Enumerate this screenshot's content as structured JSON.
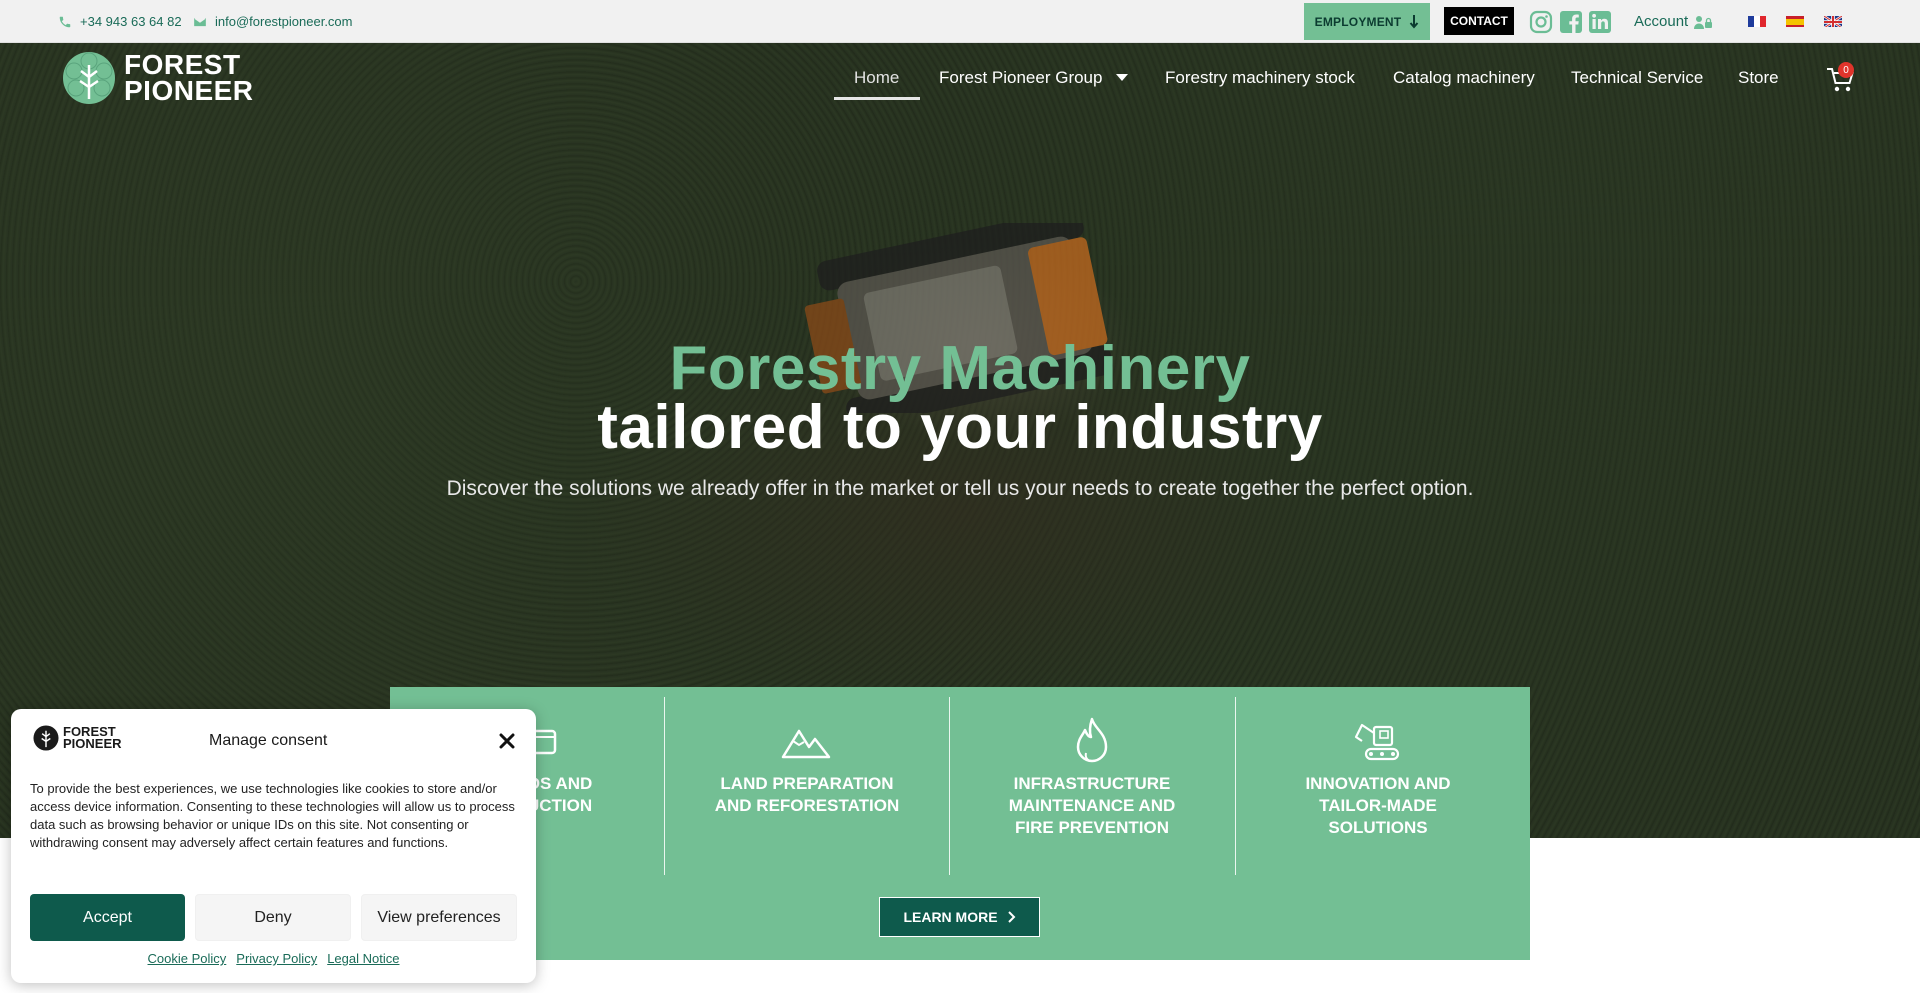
{
  "topbar": {
    "phone": "+34 943 63 64 82",
    "email": "info@forestpioneer.com",
    "employment_label": "EMPLOYMENT",
    "contact_label": "CONTACT",
    "account_label": "Account",
    "social": [
      "instagram-icon",
      "facebook-icon",
      "linkedin-icon"
    ],
    "languages": [
      "FR",
      "ES",
      "EN"
    ]
  },
  "logo": {
    "line1": "FOREST",
    "line2": "PIONEER"
  },
  "nav": {
    "items": [
      {
        "label": "Home",
        "active": true
      },
      {
        "label": "Forest Pioneer Group",
        "has_dropdown": true
      },
      {
        "label": "Forestry machinery stock"
      },
      {
        "label": "Catalog machinery"
      },
      {
        "label": "Technical Service"
      },
      {
        "label": "Store"
      }
    ],
    "cart_count": "0"
  },
  "hero": {
    "title_green": "Forestry Machinery",
    "title_white": "tailored to your industry",
    "subtitle": "Discover the solutions we already offer in the market or tell us your needs to create together the perfect option."
  },
  "services": {
    "items": [
      {
        "label": "BOARDS AND\nPRODUCTION",
        "icon": "board-icon"
      },
      {
        "label": "LAND PREPARATION\nAND REFORESTATION",
        "icon": "mountains-icon"
      },
      {
        "label": "INFRASTRUCTURE\nMAINTENANCE AND\nFIRE PREVENTION",
        "icon": "flame-icon"
      },
      {
        "label": "INNOVATION AND\nTAILOR-MADE\nSOLUTIONS",
        "icon": "excavator-icon"
      }
    ],
    "button_label": "LEARN MORE"
  },
  "cookie": {
    "logo_line1": "FOREST",
    "logo_line2": "PIONEER",
    "title": "Manage consent",
    "text": "To provide the best experiences, we use technologies like cookies to store and/or access device information. Consenting to these technologies will allow us to process data such as browsing behavior or unique IDs on this site. Not consenting or withdrawing consent may adversely affect certain features and functions.",
    "accept": "Accept",
    "deny": "Deny",
    "preferences": "View preferences",
    "links": [
      "Cookie Policy",
      "Privacy Policy",
      "Legal Notice"
    ]
  },
  "colors": {
    "brand_green": "#73bf94",
    "dark_green": "#0e5a4c",
    "text_green": "#1a6b58"
  }
}
